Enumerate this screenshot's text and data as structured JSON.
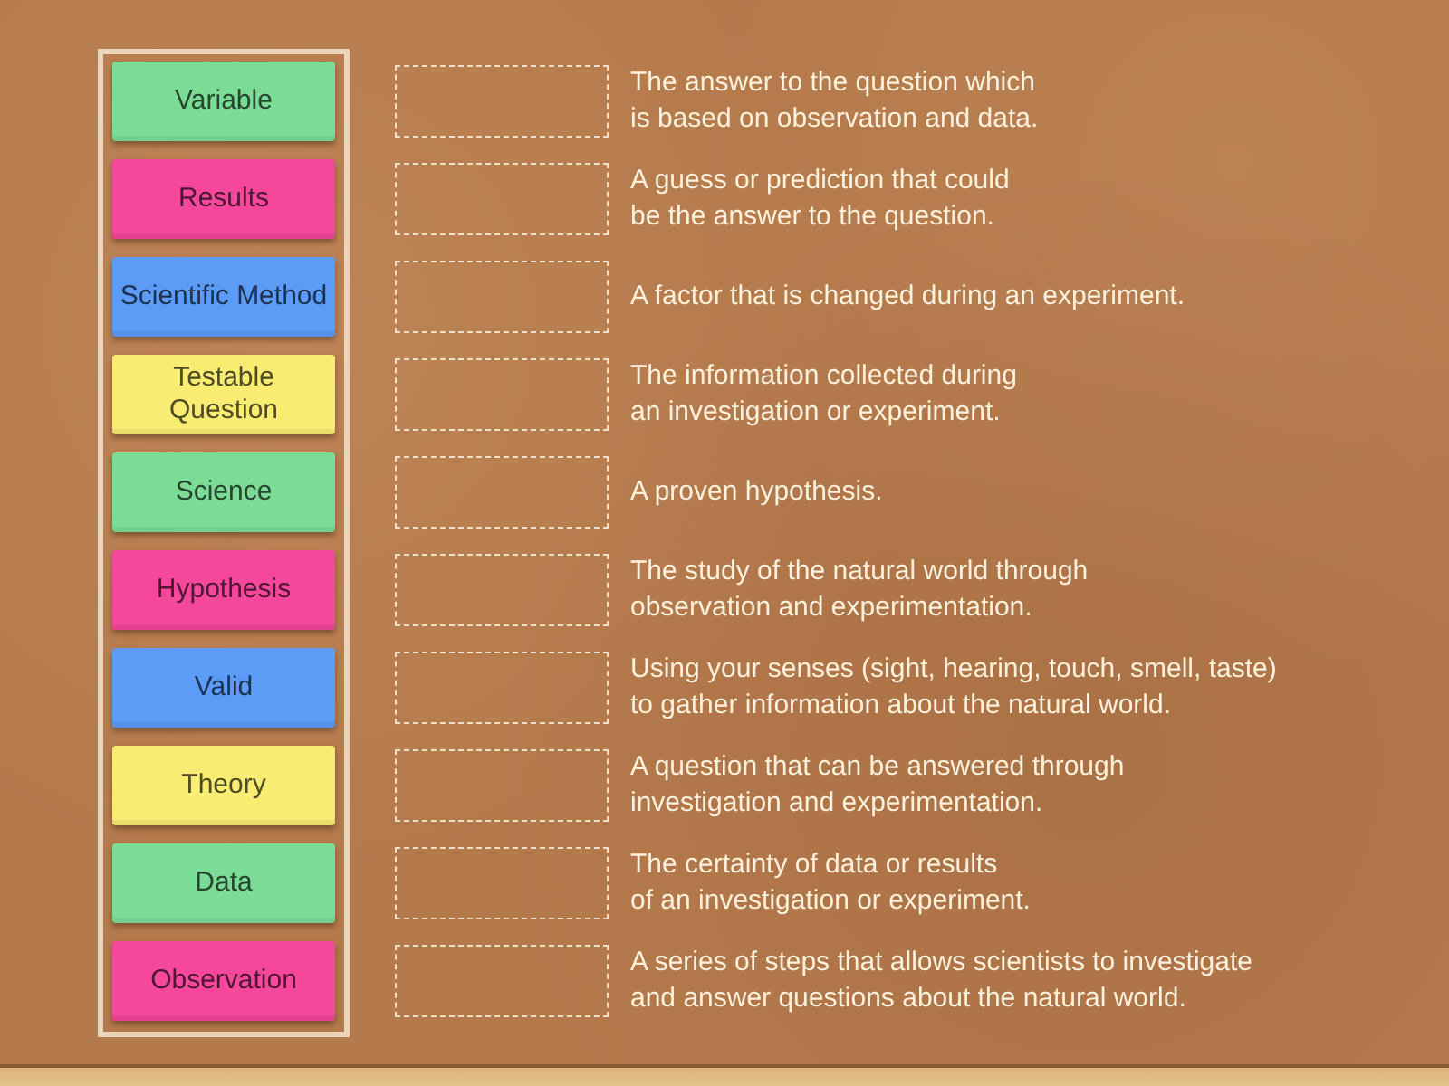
{
  "cards": [
    {
      "label": "Variable",
      "color": "#7bdc96"
    },
    {
      "label": "Results",
      "color": "#f5479b"
    },
    {
      "label": "Scientific Method",
      "color": "#5c9cf7"
    },
    {
      "label": "Testable Question",
      "color": "#f8ec72"
    },
    {
      "label": "Science",
      "color": "#7bdc96"
    },
    {
      "label": "Hypothesis",
      "color": "#f5479b"
    },
    {
      "label": "Valid",
      "color": "#5c9cf7"
    },
    {
      "label": "Theory",
      "color": "#f8ec72"
    },
    {
      "label": "Data",
      "color": "#7bdc96"
    },
    {
      "label": "Observation",
      "color": "#f5479b"
    }
  ],
  "definitions": [
    "The answer to the question which\nis based on observation and data.",
    "A guess or prediction that could\nbe the answer to the question.",
    "A factor that is changed during an experiment.",
    "The information collected during\nan investigation or experiment.",
    "A proven hypothesis.",
    "The study of the natural world through\nobservation and experimentation.",
    "Using your senses (sight, hearing, touch, smell, taste)\nto gather information about the natural world.",
    "A question that can be answered through\ninvestigation and experimentation.",
    "The certainty of data or results\nof an investigation or experiment.",
    "A series of steps that allows scientists to investigate\nand answer questions about the natural world."
  ]
}
